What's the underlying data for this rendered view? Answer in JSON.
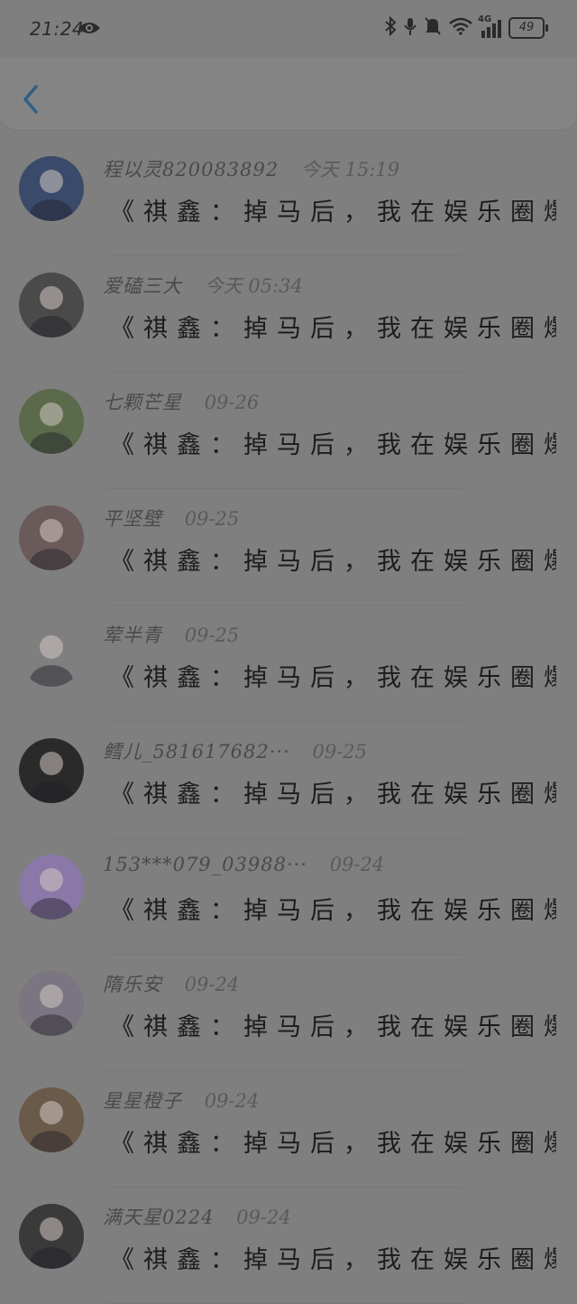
{
  "status": {
    "time": "21:24",
    "network": "4G",
    "battery": "49"
  },
  "comments": [
    {
      "user": "程以灵820083892",
      "time": "今天 15:19",
      "text": "《祺鑫：掉马后，我在娱乐圈爆火···",
      "avatar_color": "#3a4a6a"
    },
    {
      "user": "爱磕三大",
      "time": "今天 05:34",
      "text": "《祺鑫：掉马后，我在娱乐圈爆火···",
      "avatar_color": "#4a4a4a"
    },
    {
      "user": "七颗芒星",
      "time": "09-26",
      "text": "《祺鑫：掉马后，我在娱乐圈爆火···",
      "avatar_color": "#5a6a4a"
    },
    {
      "user": "平坚壁",
      "time": "09-25",
      "text": "《祺鑫：掉马后，我在娱乐圈爆火···",
      "avatar_color": "#6a5a5a"
    },
    {
      "user": "荤半青",
      "time": "09-25",
      "text": "《祺鑫：掉马后，我在娱乐圈爆火···",
      "avatar_color": "#7f7f7f"
    },
    {
      "user": "鳕儿_581617682···",
      "time": "09-25",
      "text": "《祺鑫：掉马后，我在娱乐圈爆火···",
      "avatar_color": "#2a2a2a"
    },
    {
      "user": "153***079_03988···",
      "time": "09-24",
      "text": "《祺鑫：掉马后，我在娱乐圈爆火···",
      "avatar_color": "#8a78a8"
    },
    {
      "user": "隋乐安",
      "time": "09-24",
      "text": "《祺鑫：掉马后，我在娱乐圈爆火···",
      "avatar_color": "#7a7580"
    },
    {
      "user": "星星橙子",
      "time": "09-24",
      "text": "《祺鑫：掉马后，我在娱乐圈爆火···",
      "avatar_color": "#6a5a4a"
    },
    {
      "user": "满天星0224",
      "time": "09-24",
      "text": "《祺鑫：掉马后，我在娱乐圈爆火···",
      "avatar_color": "#3a3a3a"
    }
  ]
}
